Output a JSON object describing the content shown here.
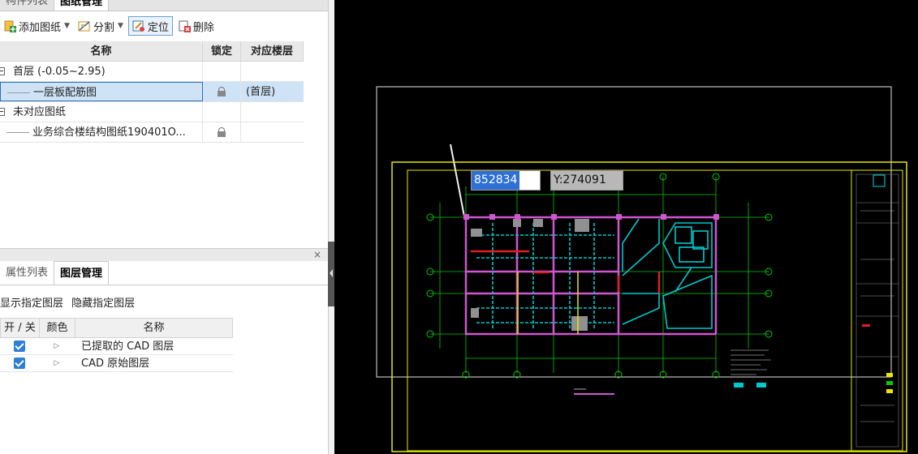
{
  "drawings_panel": {
    "tabs": [
      "构件列表",
      "图纸管理"
    ],
    "active_tab": "图纸管理",
    "toolbar": {
      "add_label": "添加图纸",
      "split_label": "分割",
      "locate_label": "定位",
      "delete_label": "删除"
    },
    "columns": [
      "名称",
      "锁定",
      "对应楼层"
    ],
    "rows": [
      {
        "name": "首层 (-0.05~2.95)",
        "locked": false,
        "floor": "",
        "group": true
      },
      {
        "name": "一层板配筋图",
        "locked": true,
        "floor": "(首层)",
        "selected": true
      },
      {
        "name": "未对应图纸",
        "locked": false,
        "floor": "",
        "group": true
      },
      {
        "name": "业务综合楼结构图纸190401O...",
        "locked": true,
        "floor": ""
      }
    ]
  },
  "layers_panel": {
    "close_label": "×",
    "tabs": [
      "属性列表",
      "图层管理"
    ],
    "active_tab": "图层管理",
    "show_label": "显示指定图层",
    "hide_label": "隐藏指定图层",
    "columns": [
      "开 / 关",
      "颜色",
      "名称"
    ],
    "rows": [
      {
        "checked": true,
        "color_arrow": "▷",
        "name": "已提取的 CAD 图层"
      },
      {
        "checked": true,
        "color_arrow": "▷",
        "name": "CAD 原始图层"
      }
    ]
  },
  "canvas": {
    "coord_x": "852834",
    "coord_y": "Y:274091",
    "colors": {
      "background": "#000000",
      "frame": "#e8e800",
      "grid": "#00cc00",
      "beam": "#d055d0",
      "slab": "#00c8d0",
      "wall_red": "#e02020",
      "selection": "#ffffff"
    }
  }
}
